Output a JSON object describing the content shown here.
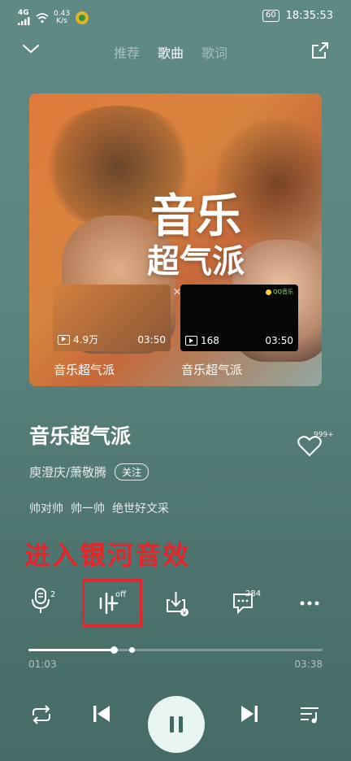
{
  "status_bar": {
    "network": "4G",
    "speed_value": "0.43",
    "speed_unit": "K/s",
    "battery": "60",
    "time": "18:35:53"
  },
  "nav": {
    "tabs": [
      {
        "label": "推荐",
        "active": false
      },
      {
        "label": "歌曲",
        "active": true
      },
      {
        "label": "歌词",
        "active": false
      }
    ]
  },
  "cover": {
    "title_line1": "音乐",
    "title_line2": "超气派"
  },
  "videos": [
    {
      "plays": "4.9万",
      "duration": "03:50",
      "label": "音乐超气派"
    },
    {
      "plays": "168",
      "duration": "03:50",
      "label": "音乐超气派",
      "logo": "QQ音乐"
    }
  ],
  "song": {
    "title": "音乐超气派",
    "artist": "庾澄庆/萧敬腾",
    "follow_label": "关注",
    "like_count": "999+",
    "tags": [
      "帅对帅",
      "帅一帅",
      "绝世好文采"
    ]
  },
  "annotation": "进入银河音效",
  "actions": {
    "mic_badge": "2",
    "effect_badge": "off",
    "comment_badge": "284"
  },
  "player": {
    "current_time": "01:03",
    "total_time": "03:38",
    "progress": 0.29,
    "buffered": 0.35
  },
  "colors": {
    "accent_red": "#e3262a",
    "background": "#5c8580"
  }
}
